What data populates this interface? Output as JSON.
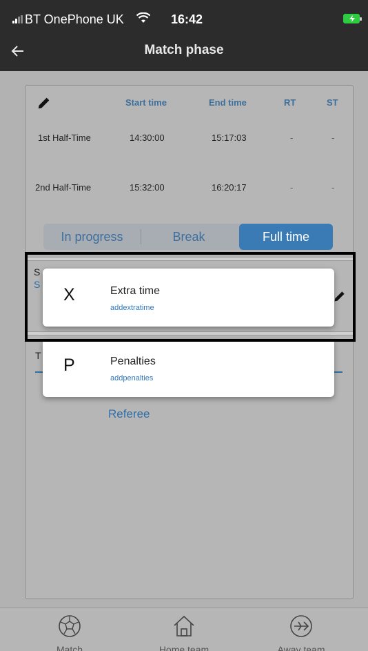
{
  "status_bar": {
    "carrier": "BT OnePhone UK",
    "time": "16:42"
  },
  "app_bar": {
    "title": "Match phase"
  },
  "table": {
    "headers": [
      "Start time",
      "End time",
      "RT",
      "ST"
    ],
    "rows": [
      {
        "label": "1st Half-Time",
        "start": "14:30:00",
        "end": "15:17:03",
        "rt": "-",
        "st": "-"
      },
      {
        "label": "2nd Half-Time",
        "start": "15:32:00",
        "end": "16:20:17",
        "rt": "-",
        "st": "-"
      }
    ]
  },
  "segmented": {
    "options": [
      "In progress",
      "Break",
      "Full time"
    ],
    "selected": "Full time"
  },
  "obscured": {
    "s1": "S",
    "s2": "S",
    "t": "T"
  },
  "referee_link": "Referee",
  "popup_menu": [
    {
      "letter": "X",
      "label": "Extra time",
      "code": "addextratime"
    },
    {
      "letter": "P",
      "label": "Penalties",
      "code": "addpenalties"
    }
  ],
  "bottom_nav": [
    {
      "label": "Match",
      "icon": "football-icon"
    },
    {
      "label": "Home team",
      "icon": "home-icon"
    },
    {
      "label": "Away team",
      "icon": "airplane-icon"
    }
  ],
  "colors": {
    "accent": "#3a7bb5",
    "link": "#2f79c0",
    "app_bar": "#2c2c2c"
  }
}
